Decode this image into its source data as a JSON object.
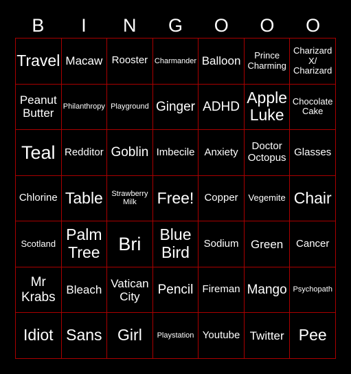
{
  "header": {
    "letters": [
      "B",
      "I",
      "N",
      "G",
      "O",
      "O",
      "O"
    ]
  },
  "colors": {
    "background": "#000000",
    "grid_line": "#aa0000",
    "text": "#ffffff"
  },
  "board": {
    "rows": [
      [
        {
          "text": "Travel",
          "size": "l"
        },
        {
          "text": "Macaw",
          "size": "ms"
        },
        {
          "text": "Rooster",
          "size": "s"
        },
        {
          "text": "Charmander",
          "size": "xxs"
        },
        {
          "text": "Balloon",
          "size": "ms"
        },
        {
          "text": "Prince Charming",
          "size": "xs"
        },
        {
          "text": "Charizard X/ Charizard",
          "size": "xs"
        }
      ],
      [
        {
          "text": "Peanut Butter",
          "size": "ms"
        },
        {
          "text": "Philanthropy",
          "size": "xxs"
        },
        {
          "text": "Playground",
          "size": "xxs"
        },
        {
          "text": "Ginger",
          "size": "m"
        },
        {
          "text": "ADHD",
          "size": "m"
        },
        {
          "text": "Apple Luke",
          "size": "l"
        },
        {
          "text": "Chocolate Cake",
          "size": "xs"
        }
      ],
      [
        {
          "text": "Teal",
          "size": "xl"
        },
        {
          "text": "Redditor",
          "size": "s"
        },
        {
          "text": "Goblin",
          "size": "m"
        },
        {
          "text": "Imbecile",
          "size": "s"
        },
        {
          "text": "Anxiety",
          "size": "s"
        },
        {
          "text": "Doctor Octopus",
          "size": "s"
        },
        {
          "text": "Glasses",
          "size": "s"
        }
      ],
      [
        {
          "text": "Chlorine",
          "size": "s"
        },
        {
          "text": "Table",
          "size": "l"
        },
        {
          "text": "Strawberry Milk",
          "size": "xxs"
        },
        {
          "text": "Free!",
          "size": "l"
        },
        {
          "text": "Copper",
          "size": "s"
        },
        {
          "text": "Vegemite",
          "size": "xs"
        },
        {
          "text": "Chair",
          "size": "l"
        }
      ],
      [
        {
          "text": "Scotland",
          "size": "xs"
        },
        {
          "text": "Palm Tree",
          "size": "l"
        },
        {
          "text": "Bri",
          "size": "xl"
        },
        {
          "text": "Blue Bird",
          "size": "l"
        },
        {
          "text": "Sodium",
          "size": "s"
        },
        {
          "text": "Green",
          "size": "ms"
        },
        {
          "text": "Cancer",
          "size": "s"
        }
      ],
      [
        {
          "text": "Mr Krabs",
          "size": "m"
        },
        {
          "text": "Bleach",
          "size": "ms"
        },
        {
          "text": "Vatican City",
          "size": "ms"
        },
        {
          "text": "Pencil",
          "size": "m"
        },
        {
          "text": "Fireman",
          "size": "s"
        },
        {
          "text": "Mango",
          "size": "m"
        },
        {
          "text": "Psychopath",
          "size": "xxs"
        }
      ],
      [
        {
          "text": "Idiot",
          "size": "l"
        },
        {
          "text": "Sans",
          "size": "l"
        },
        {
          "text": "Girl",
          "size": "l"
        },
        {
          "text": "Playstation",
          "size": "xxs"
        },
        {
          "text": "Youtube",
          "size": "s"
        },
        {
          "text": "Twitter",
          "size": "ms"
        },
        {
          "text": "Pee",
          "size": "l"
        }
      ]
    ]
  }
}
